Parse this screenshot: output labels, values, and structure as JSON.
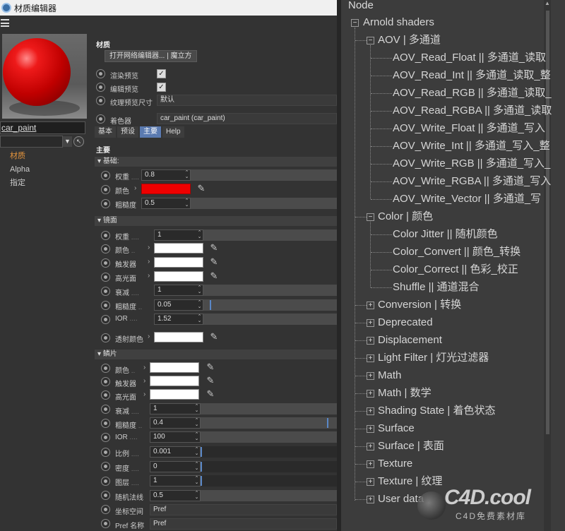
{
  "window": {
    "title": "材质编辑器"
  },
  "left": {
    "material_name": "car_paint",
    "channels": [
      "材质",
      "Alpha",
      "指定"
    ]
  },
  "right": {
    "section_material": "材质",
    "open_button": "打开网络编辑器... | 魔立方",
    "render_preview": "渲染预览",
    "editor_preview": "编辑预览",
    "texture_size": "纹理预览尺寸",
    "texture_size_value": "默认",
    "shader": "着色器",
    "shader_value": "car_paint (car_paint)",
    "tabs": [
      "基本",
      "预设",
      "主要",
      "Help"
    ],
    "main_title": "主要",
    "base": {
      "title": "基础:",
      "weight_label": "权重",
      "weight": "0.8",
      "color_label": "颜色",
      "color": "#ee0000",
      "roughness_label": "粗糙度",
      "roughness": "0.5"
    },
    "specular": {
      "title": "镜面",
      "weight_label": "权重",
      "weight": "1",
      "color_label": "颜色",
      "emitter_label": "触发器",
      "highlight_label": "高光面",
      "falloff_label": "衰减",
      "falloff": "1",
      "roughness_label": "粗糙度",
      "roughness": "0.05",
      "roughness_level": 0.05,
      "ior_label": "IOR",
      "ior": "1.52",
      "transmission_label": "透射颜色"
    },
    "flakes": {
      "title": "鳞片",
      "color_label": "颜色",
      "emitter_label": "触发器",
      "highlight_label": "高光面",
      "falloff_label": "衰减",
      "falloff": "1",
      "roughness_label": "粗糙度",
      "roughness": "0.4",
      "roughness_level": 0.95,
      "ior_label": "IOR",
      "ior": "100",
      "scale_label": "比例",
      "scale": "0.001",
      "density_label": "密度",
      "density": "0",
      "layers_label": "图层",
      "layers": "1",
      "normal_label": "随机法线",
      "normal": "0.5",
      "coord_label": "坐标空间",
      "coord": "Pref",
      "pref_label": "Pref 名称",
      "pref": "Pref"
    }
  },
  "node_panel": {
    "header": "Node",
    "root": "Arnold shaders",
    "aov": "AOV | 多通道",
    "aov_items": [
      "AOV_Read_Float || 多通道_读取",
      "AOV_Read_Int || 多通道_读取_整",
      "AOV_Read_RGB || 多通道_读取_",
      "AOV_Read_RGBA || 多通道_读取",
      "AOV_Write_Float || 多通道_写入",
      "AOV_Write_Int || 多通道_写入_整",
      "AOV_Write_RGB || 多通道_写入_",
      "AOV_Write_RGBA || 多通道_写入",
      "AOV_Write_Vector || 多通道_写"
    ],
    "color": "Color | 颜色",
    "color_items": [
      "Color Jitter || 随机颜色",
      "Color_Convert || 颜色_转换",
      "Color_Correct || 色彩_校正",
      "Shuffle || 通道混合"
    ],
    "collapsed": [
      "Conversion | 转换",
      "Deprecated",
      "Displacement",
      "Light Filter | 灯光过滤器",
      "Math",
      "Math | 数学",
      "Shading State | 着色状态",
      "Surface",
      "Surface | 表面",
      "Texture",
      "Texture | 纹理",
      "User data"
    ]
  },
  "watermark": {
    "brand": "C4D.cool",
    "sub": "C4D免费素材库"
  }
}
